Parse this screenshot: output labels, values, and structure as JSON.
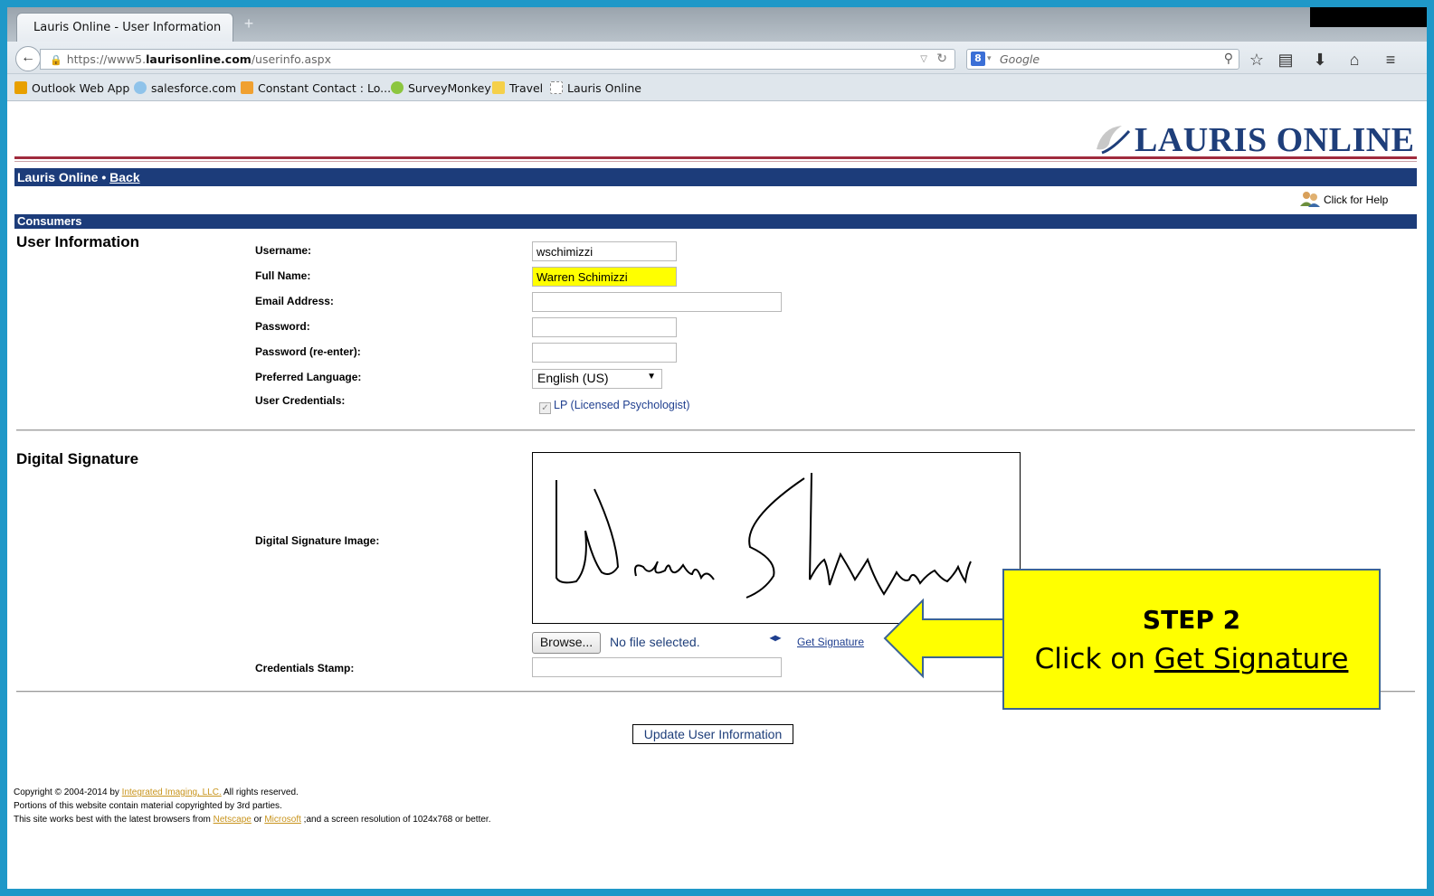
{
  "browser": {
    "tab_title": "Lauris Online - User Information",
    "new_tab": "+",
    "url_prefix": "https://www5.",
    "url_domain": "laurisonline.com",
    "url_path": "/userinfo.aspx",
    "search_placeholder": "Google",
    "bookmarks": [
      {
        "label": "Outlook Web App",
        "icon": "outlook-icon",
        "color": "#e8a000"
      },
      {
        "label": "salesforce.com",
        "icon": "salesforce-icon",
        "color": "#8fc3ea"
      },
      {
        "label": "Constant Contact : Lo...",
        "icon": "constant-contact-icon",
        "color": "#f0a030"
      },
      {
        "label": "SurveyMonkey",
        "icon": "surveymonkey-icon",
        "color": "#8cc63f"
      },
      {
        "label": "Travel",
        "icon": "folder-icon",
        "color": "#f5d04a"
      },
      {
        "label": "Lauris Online",
        "icon": "page-icon",
        "color": "#ffffff"
      }
    ]
  },
  "header": {
    "logo_text": "LAURIS ONLINE",
    "nav_prefix": "Lauris Online • ",
    "nav_back": "Back",
    "help": "Click for Help",
    "section_bar": "Consumers"
  },
  "user_info": {
    "title": "User Information",
    "username_label": "Username:",
    "username_value": "wschimizzi",
    "fullname_label": "Full Name:",
    "fullname_value": "Warren Schimizzi",
    "email_label": "Email Address:",
    "email_value": "",
    "password_label": "Password:",
    "password_reenter_label": "Password (re-enter):",
    "language_label": "Preferred Language:",
    "language_value": "English (US)",
    "credentials_label": "User Credentials:",
    "credentials_value": "LP (Licensed Psychologist)",
    "credentials_checked": true
  },
  "digital_signature": {
    "title": "Digital Signature",
    "image_label": "Digital Signature Image:",
    "browse_button": "Browse...",
    "no_file": "No file selected.",
    "get_signature": "Get Signature",
    "stamp_label": "Credentials Stamp:"
  },
  "actions": {
    "update_button": "Update User Information"
  },
  "footer": {
    "line1_prefix": "Copyright © 2004-2014 by ",
    "line1_link": "Integrated Imaging, LLC.",
    "line1_suffix": " All rights reserved.",
    "line2": "Portions of this website contain material copyrighted by 3rd parties.",
    "line3_prefix": "This site works best with the latest browsers from ",
    "line3_link1": "Netscape",
    "line3_mid": " or ",
    "line3_link2": "Microsoft",
    "line3_suffix": " ;and a screen resolution of 1024x768 or better."
  },
  "callout": {
    "step": "STEP 2",
    "instruction_prefix": "Click on ",
    "instruction_link": "Get Signature"
  },
  "colors": {
    "frame_border": "#1f98c8",
    "nav_blue": "#1c3c7a",
    "logo_red": "#a02b3d",
    "highlight_yellow": "#ffff00",
    "link_gold": "#c8941d"
  }
}
